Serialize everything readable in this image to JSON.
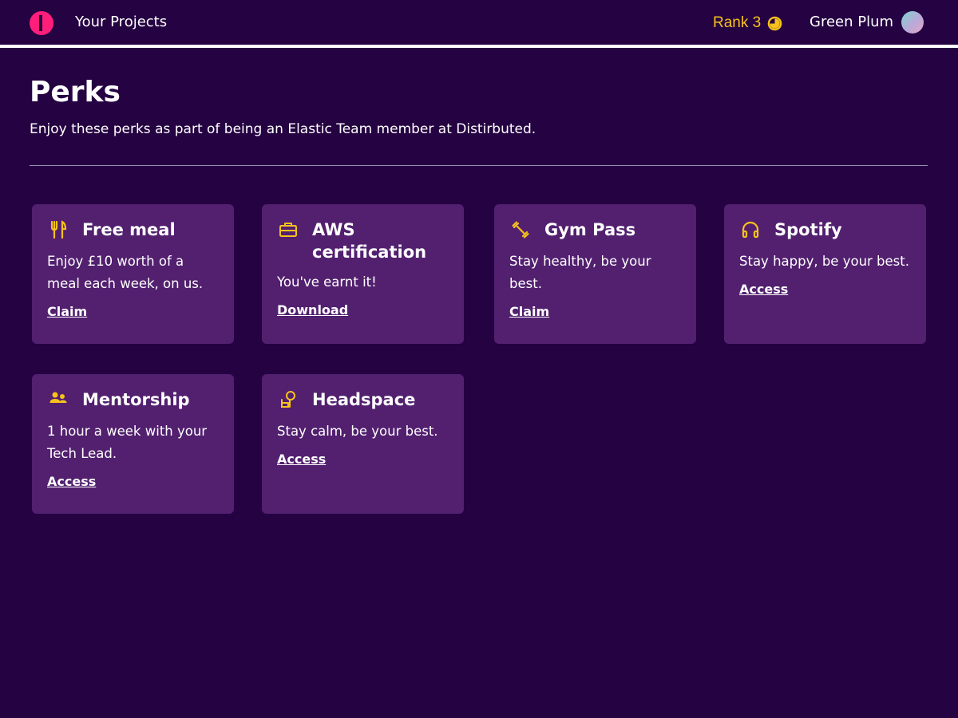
{
  "header": {
    "projects_label": "Your Projects",
    "rank_label": "Rank 3",
    "user_name": "Green Plum"
  },
  "main": {
    "title": "Perks",
    "subtitle": "Enjoy these perks as part of being an Elastic Team member at Distirbuted."
  },
  "perks": [
    {
      "title": "Free meal",
      "description": "Enjoy £10 worth of a meal each week, on us.",
      "action": "Claim",
      "icon": "cutlery-icon"
    },
    {
      "title": "AWS certification",
      "description": "You've earnt it!",
      "action": "Download",
      "icon": "briefcase-icon"
    },
    {
      "title": "Gym Pass",
      "description": "Stay healthy, be your best.",
      "action": "Claim",
      "icon": "dumbbell-icon"
    },
    {
      "title": "Spotify",
      "description": "Stay happy, be your best.",
      "action": "Access",
      "icon": "headphones-icon"
    },
    {
      "title": "Mentorship",
      "description": "1 hour a week with your Tech Lead.",
      "action": "Access",
      "icon": "people-icon"
    },
    {
      "title": "Headspace",
      "description": "Stay calm, be your best.",
      "action": "Access",
      "icon": "meditation-icon"
    }
  ],
  "colors": {
    "background": "#250242",
    "card": "#52206f",
    "accent": "#f7c21c",
    "brand": "#ff1e7a",
    "text": "#ffffff"
  }
}
